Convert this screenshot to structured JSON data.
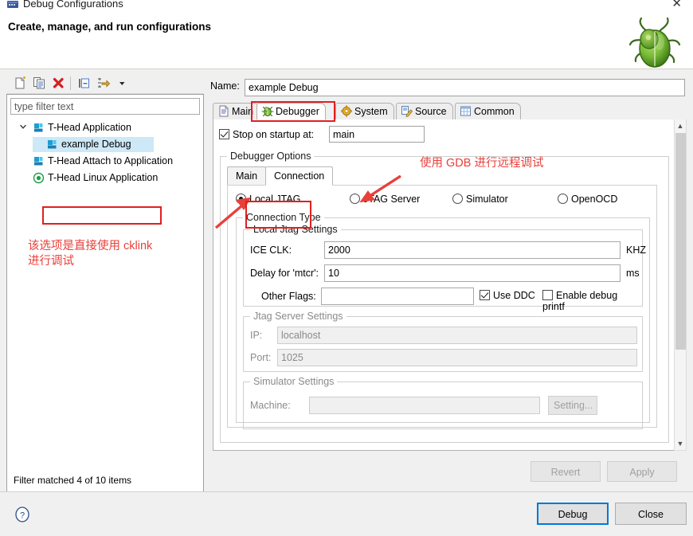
{
  "window": {
    "title": "Debug Configurations",
    "icon": "debug-configurations-icon",
    "close_label": "✕",
    "header_title": "Create, manage, and run configurations",
    "decoration_icon": "green-bug-icon"
  },
  "toolbar": {
    "buttons": [
      {
        "name": "new-configuration-icon",
        "tooltip": "New launch configuration"
      },
      {
        "name": "duplicate-configuration-icon",
        "tooltip": "Duplicate"
      },
      {
        "name": "delete-configuration-icon",
        "tooltip": "Delete"
      },
      {
        "name": "collapse-all-icon",
        "tooltip": "Collapse All"
      },
      {
        "name": "filter-launch-configurations-icon",
        "tooltip": "Filter"
      },
      {
        "name": "view-menu-chevron-icon",
        "tooltip": "View Menu"
      }
    ]
  },
  "filter": {
    "placeholder": "type filter text",
    "value": "",
    "status": "Filter matched 4 of 10 items"
  },
  "tree": {
    "items": [
      {
        "label": "T-Head Application",
        "icon": "app-launch-icon",
        "depth": 0,
        "expanded": true,
        "selected": false
      },
      {
        "label": "example Debug",
        "icon": "app-launch-icon",
        "depth": 1,
        "expanded": null,
        "selected": true
      },
      {
        "label": "T-Head Attach to Application",
        "icon": "app-launch-icon",
        "depth": 0,
        "expanded": null,
        "selected": false
      },
      {
        "label": "T-Head Linux Application",
        "icon": "linux-target-icon",
        "depth": 0,
        "expanded": null,
        "selected": false
      }
    ]
  },
  "config": {
    "name_label": "Name:",
    "name_value": "example Debug",
    "tabs": [
      {
        "label": "Main",
        "icon": "document-icon",
        "active": false
      },
      {
        "label": "Debugger",
        "icon": "bug-icon",
        "active": true
      },
      {
        "label": "System",
        "icon": "gear-icon",
        "active": false
      },
      {
        "label": "Source",
        "icon": "source-edit-icon",
        "active": false
      },
      {
        "label": "Common",
        "icon": "table-icon",
        "active": false
      }
    ],
    "stop_on_startup": {
      "label": "Stop on startup at:",
      "checked": true,
      "value": "main"
    },
    "debugger_options": {
      "group_label": "Debugger Options",
      "inner_tabs": [
        {
          "label": "Main",
          "active": false
        },
        {
          "label": "Connection",
          "active": true
        }
      ],
      "connection_modes": [
        {
          "label": "Local JTAG",
          "selected": true
        },
        {
          "label": "JTAG Server",
          "selected": false
        },
        {
          "label": "Simulator",
          "selected": false
        },
        {
          "label": "OpenOCD",
          "selected": false
        }
      ],
      "connection_type_label": "Connection Type",
      "local_jtag": {
        "group_label": "Local Jtag Settings",
        "ice_clk_label": "ICE CLK:",
        "ice_clk_value": "2000",
        "ice_clk_unit": "KHZ",
        "delay_label": "Delay for 'mtcr':",
        "delay_value": "10",
        "delay_unit": "ms",
        "other_flags_label": "Other Flags:",
        "other_flags_value": "",
        "use_ddc_label": "Use DDC",
        "use_ddc_checked": true,
        "enable_printf_label": "Enable debug printf",
        "enable_printf_checked": false
      },
      "jtag_server": {
        "group_label": "Jtag Server Settings",
        "ip_label": "IP:",
        "ip_value": "localhost",
        "port_label": "Port:",
        "port_value": "1025"
      },
      "simulator": {
        "group_label": "Simulator Settings",
        "machine_label": "Machine:",
        "machine_value": "",
        "setting_button": "Setting..."
      }
    },
    "revert_button": "Revert",
    "apply_button": "Apply"
  },
  "footer": {
    "help_icon": "help-icon",
    "debug_button": "Debug",
    "close_button": "Close"
  },
  "annotations": [
    {
      "name": "annotation-cklink",
      "text": "该选项是直接使用 cklink\n进行调试"
    },
    {
      "name": "annotation-gdb",
      "text": "使用 GDB 进行远程调试"
    }
  ],
  "colors": {
    "annotation_red": "#e8403a",
    "highlight_box_red": "#e02020",
    "selection_blue": "#cde8f6",
    "primary_border": "#0078d7"
  }
}
